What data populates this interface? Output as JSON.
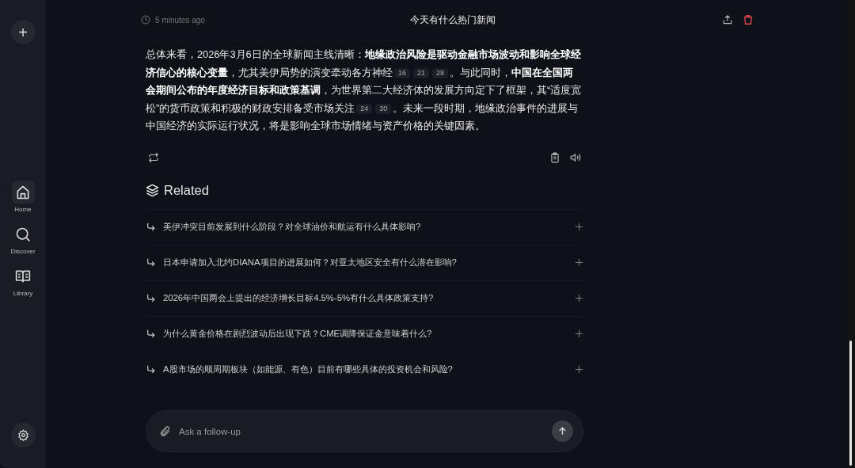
{
  "sidebar": {
    "new_button": "+",
    "items": [
      {
        "label": "Home",
        "selected": true
      },
      {
        "label": "Discover",
        "selected": false
      },
      {
        "label": "Library",
        "selected": false
      }
    ]
  },
  "header": {
    "time": "5 minutes ago",
    "title": "今天有什么热门新闻"
  },
  "answer": [
    {
      "kind": "text",
      "text": "总体来看，2026年3月6日的全球新闻主线清晰：**地缘政治风险是驱动金融市场波动和影响全球经济信心的核心变量**，尤其美伊局势的演变牵动各方神经"
    },
    {
      "kind": "cite",
      "text": "16"
    },
    {
      "kind": "cite",
      "text": "21"
    },
    {
      "kind": "cite",
      "text": "28"
    },
    {
      "kind": "text",
      "text": "。与此同时，**中国在全国两会期间公布的年度经济目标和政策基调**，为世界第二大经济体的发展方向定下了框架，其“适度宽松”的货币政策和积极的财政安排备受市场关注"
    },
    {
      "kind": "cite",
      "text": "24"
    },
    {
      "kind": "cite",
      "text": "30"
    },
    {
      "kind": "text",
      "text": "。未来一段时期，地缘政治事件的进展与中国经济的实际运行状况，将是影响全球市场情绪与资产价格的关键因素。"
    }
  ],
  "related": {
    "title": "Related",
    "items": [
      "美伊冲突目前发展到什么阶段？对全球油价和航运有什么具体影响?",
      "日本申请加入北约DIANA项目的进展如何？对亚太地区安全有什么潜在影响?",
      "2026年中国两会上提出的经济增长目标4.5%-5%有什么具体政策支持?",
      "为什么黄金价格在剧烈波动后出现下跌？CME调降保证金意味着什么?",
      "A股市场的顺周期板块（如能源、有色）目前有哪些具体的投资机会和风险?"
    ]
  },
  "followup": {
    "placeholder": "Ask a follow-up"
  }
}
